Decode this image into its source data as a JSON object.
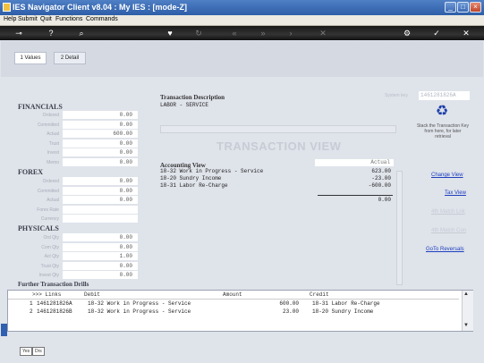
{
  "window": {
    "title": "IES Navigator Client v8.04 : My IES :       [mode-Z]"
  },
  "menu": [
    "Help",
    "Submit",
    "Quit",
    "Functions",
    "Commands"
  ],
  "tabs": [
    {
      "label": "1 Values",
      "active": true
    },
    {
      "label": "2 Detail",
      "active": false
    }
  ],
  "financials": {
    "heading": "FINANCIALS",
    "rows": [
      {
        "label": "Ordered",
        "value": "0.00"
      },
      {
        "label": "Committed",
        "value": "0.00"
      },
      {
        "label": "Actual",
        "value": "600.00"
      },
      {
        "label": "Trust",
        "value": "0.00"
      },
      {
        "label": "Invest",
        "value": "0.00"
      },
      {
        "label": "Memo",
        "value": "0.00"
      }
    ]
  },
  "forex": {
    "heading": "FOREX",
    "rows": [
      {
        "label": "Ordered",
        "value": "0.00"
      },
      {
        "label": "Committed",
        "value": "0.00"
      },
      {
        "label": "Actual",
        "value": "0.00"
      },
      {
        "label": "Forex Rate",
        "value": ""
      },
      {
        "label": "Currency",
        "value": ""
      }
    ]
  },
  "physicals": {
    "heading": "PHYSICALS",
    "rows": [
      {
        "label": "Ord Qty",
        "value": "0.00"
      },
      {
        "label": "Com Qty",
        "value": "0.00"
      },
      {
        "label": "Act Qty",
        "value": "1.00"
      },
      {
        "label": "Trust Qty",
        "value": "0.00"
      },
      {
        "label": "Invest Qty",
        "value": "0.00"
      }
    ]
  },
  "transaction": {
    "desc_heading": "Transaction Description",
    "desc_value": "LABOR - SERVICE",
    "system_key_label": "System key",
    "system_key_value": "1461281826A",
    "watermark": "TRANSACTION VIEW",
    "accounting_heading": "Accounting View",
    "actual_header": "Actual",
    "lines": [
      {
        "account": "18-32 Work in Progress - Service",
        "amount": "623.00"
      },
      {
        "account": "18-20 Sundry Income",
        "amount": "-23.00"
      },
      {
        "account": "18-31 Labor Re-Charge",
        "amount": "-600.00"
      }
    ],
    "total": "0.00"
  },
  "side": {
    "hint": "Stack the Transaction Key from here, for later retrieval",
    "links": [
      {
        "label": "Change View",
        "enabled": true
      },
      {
        "label": "Tax View",
        "enabled": true
      },
      {
        "label": "4th Match Lnk",
        "enabled": false
      },
      {
        "label": "4th Match Con",
        "enabled": false
      },
      {
        "label": "GoTo Reversals",
        "enabled": true
      }
    ]
  },
  "drills": {
    "heading": "Further Transaction Drills",
    "headers": {
      "links": ">>> Links",
      "debit": "Debit",
      "amount": "Amount",
      "credit": "Credit"
    },
    "rows": [
      {
        "n": "1",
        "link": "1461281826A",
        "debit": "18-32 Work in Progress - Service",
        "amount": "600.00",
        "credit": "18-31 Labor Re-Charge"
      },
      {
        "n": "2",
        "link": "1461281826B",
        "debit": "18-32 Work in Progress - Service",
        "amount": "23.00",
        "credit": "18-20 Sundry Income"
      }
    ]
  },
  "status": {
    "btn1": "Yes",
    "btn2": "Drs"
  }
}
